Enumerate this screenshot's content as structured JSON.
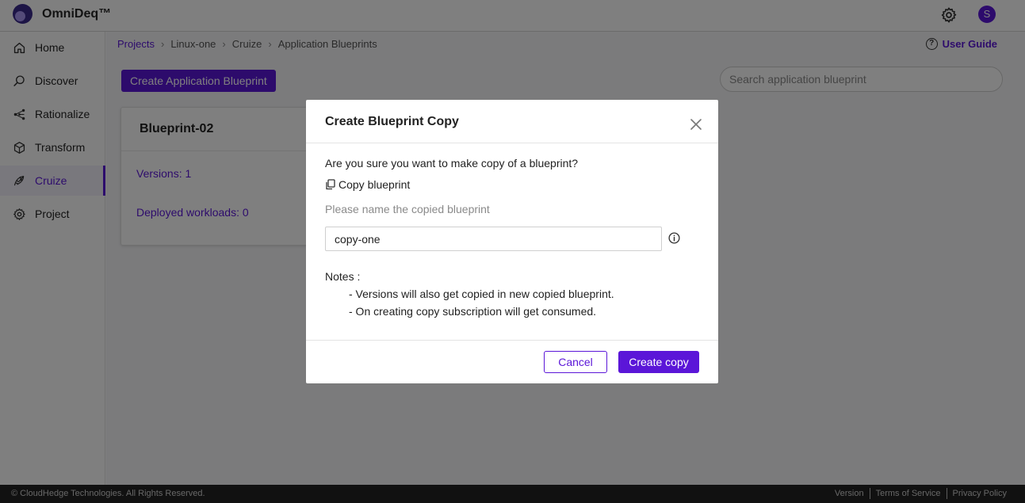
{
  "app": {
    "title": "OmniDeq™",
    "user_initial": "S"
  },
  "sidebar": {
    "items": [
      {
        "label": "Home",
        "icon": "home-icon"
      },
      {
        "label": "Discover",
        "icon": "discover-icon"
      },
      {
        "label": "Rationalize",
        "icon": "rationalize-icon"
      },
      {
        "label": "Transform",
        "icon": "transform-icon"
      },
      {
        "label": "Cruize",
        "icon": "cruize-icon",
        "active": true
      },
      {
        "label": "Project",
        "icon": "project-icon"
      }
    ]
  },
  "breadcrumb": [
    "Projects",
    "Linux-one",
    "Cruize",
    "Application Blueprints"
  ],
  "header": {
    "user_guide": "User Guide"
  },
  "toolbar": {
    "create_label": "Create Application Blueprint",
    "search_placeholder": "Search application blueprint"
  },
  "card": {
    "title": "Blueprint-02",
    "versions": "Versions: 1",
    "deployed": "Deployed workloads: 0"
  },
  "modal": {
    "title": "Create Blueprint Copy",
    "question": "Are you sure you want to make copy of a blueprint?",
    "copy_label": "Copy blueprint",
    "name_label": "Please name the copied blueprint",
    "name_value": "copy-one",
    "notes_title": "Notes :",
    "notes": [
      "- Versions will also get copied in new copied blueprint.",
      "- On creating copy subscription will get consumed."
    ],
    "cancel_label": "Cancel",
    "confirm_label": "Create copy"
  },
  "footer": {
    "copyright": "© CloudHedge Technologies. All Rights Reserved.",
    "links": [
      "Version",
      "Terms of Service",
      "Privacy Policy"
    ]
  },
  "colors": {
    "accent": "#5b16d8",
    "footer_bg": "#222222",
    "overlay": "rgba(0,0,0,0.5)"
  }
}
